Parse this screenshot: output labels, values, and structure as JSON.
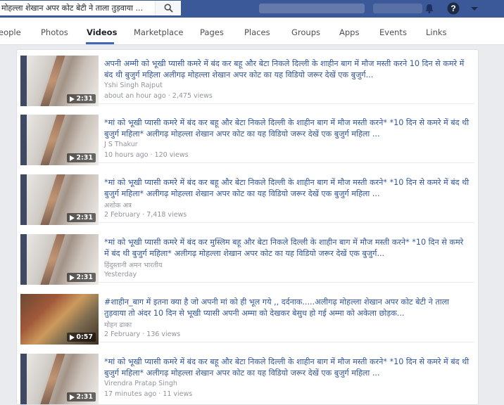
{
  "search": {
    "value": "मोहल्ला शेखान अपर कोट बेटी ने ताला तुड़वाया ..."
  },
  "nav": {
    "tabs": [
      "eople",
      "Photos",
      "Videos",
      "Marketplace",
      "Pages",
      "Places",
      "Groups",
      "Apps",
      "Events",
      "Links"
    ],
    "active": "Videos"
  },
  "icons": {
    "search": "search-icon",
    "help": "help-icon",
    "menu": "chevron-down-icon",
    "play": "play-icon"
  },
  "colors": {
    "brand": "#3b5998",
    "link": "#365899",
    "muted": "#90949c"
  },
  "results": [
    {
      "title": "अपनी अम्मी को भूखी प्यासी कमरे में बंद कर बहू और बेटा निकले दिल्ली के शाहीन बाग में मौज मस्ती करने 10 दिन से कमरे में बंद थी बुजुर्ग महिला अलीगढ़ मोहल्ला शेखान अपर कोट का यह विडियो जरूर देखें एक बुजुर्ग...",
      "author": "Yshi Singh Rajput",
      "meta": "about an hour ago · 2,475 views",
      "duration": "2:31"
    },
    {
      "title": "*मां को भूखी प्यासी कमरे में बंद कर बहू और बेटा निकले दिल्ली के शाहीन बाग में मौज मस्ती करने* *10 दिन से कमरे में बंद थी बुजुर्ग महिला* अलीगढ़ मोहल्ला शेखान अपर कोट का यह विडियो जरूर देखें एक बुजुर्ग महिला ...",
      "author": "J S Thakur",
      "meta": "10 hours ago · 120 views",
      "duration": "2:31"
    },
    {
      "title": "*मां को भूखी प्यासी कमरे में बंद कर बहू और बेटा निकले दिल्ली के शाहीन बाग में मौज मस्ती करने* *10 दिन से कमरे में बंद थी बुजुर्ग महिला* अलीगढ़ मोहल्ला शेखान अपर कोट का यह विडियो जरूर देखें एक बुजुर्ग महिला ...",
      "author": "अशोक अत्र",
      "meta": "2 February · 7,418 views",
      "duration": "2:31"
    },
    {
      "title": "*मां को भूखी प्यासी कमरे में बंद कर मुस्लिम बहू और बेटा निकले दिल्ली के शाहीन बाग में मौज मस्ती करने* *10 दिन से कमरे में बंद थी बुजुर्ग महिला* अलीगढ़ मोहल्ला शेखान अपर कोट का यह विडियो जरूर देखें एक बुजुर्ग...",
      "author": "हिंदुस्तानी अमन भारतीय",
      "meta": "Yesterday",
      "duration": "2:31"
    },
    {
      "title": "#शाहीन_बाग में इतना क्या है जो अपनी मां को ही भूल गये ,, दर्दनाक.....अलीगढ़ मोहल्ला शेखान अपर कोट बेटी ने ताला तुड़वाया तो अंदर 10 दिन से भूखी प्यासी अपनी अम्मा को देखकर बेसुध हो गई अम्मा को अकेला छोड़क...",
      "author": "मोहन ढाका",
      "meta": "2 February · 136 views",
      "duration": "0:57"
    },
    {
      "title": "*मां को भूखी प्यासी कमरे में बंद कर बहू और बेटा निकले दिल्ली के शाहीन बाग में मौज मस्ती करने* *10 दिन से कमरे में बंद थी बुजुर्ग महिला* अलीगढ़ मोहल्ला शेखान अपर कोट का यह विडियो जरूर देखें एक बुजुर्ग महिला ...",
      "author": "Virendra Pratap Singh",
      "meta": "17 minutes ago · 11 views",
      "duration": "2:31"
    }
  ]
}
